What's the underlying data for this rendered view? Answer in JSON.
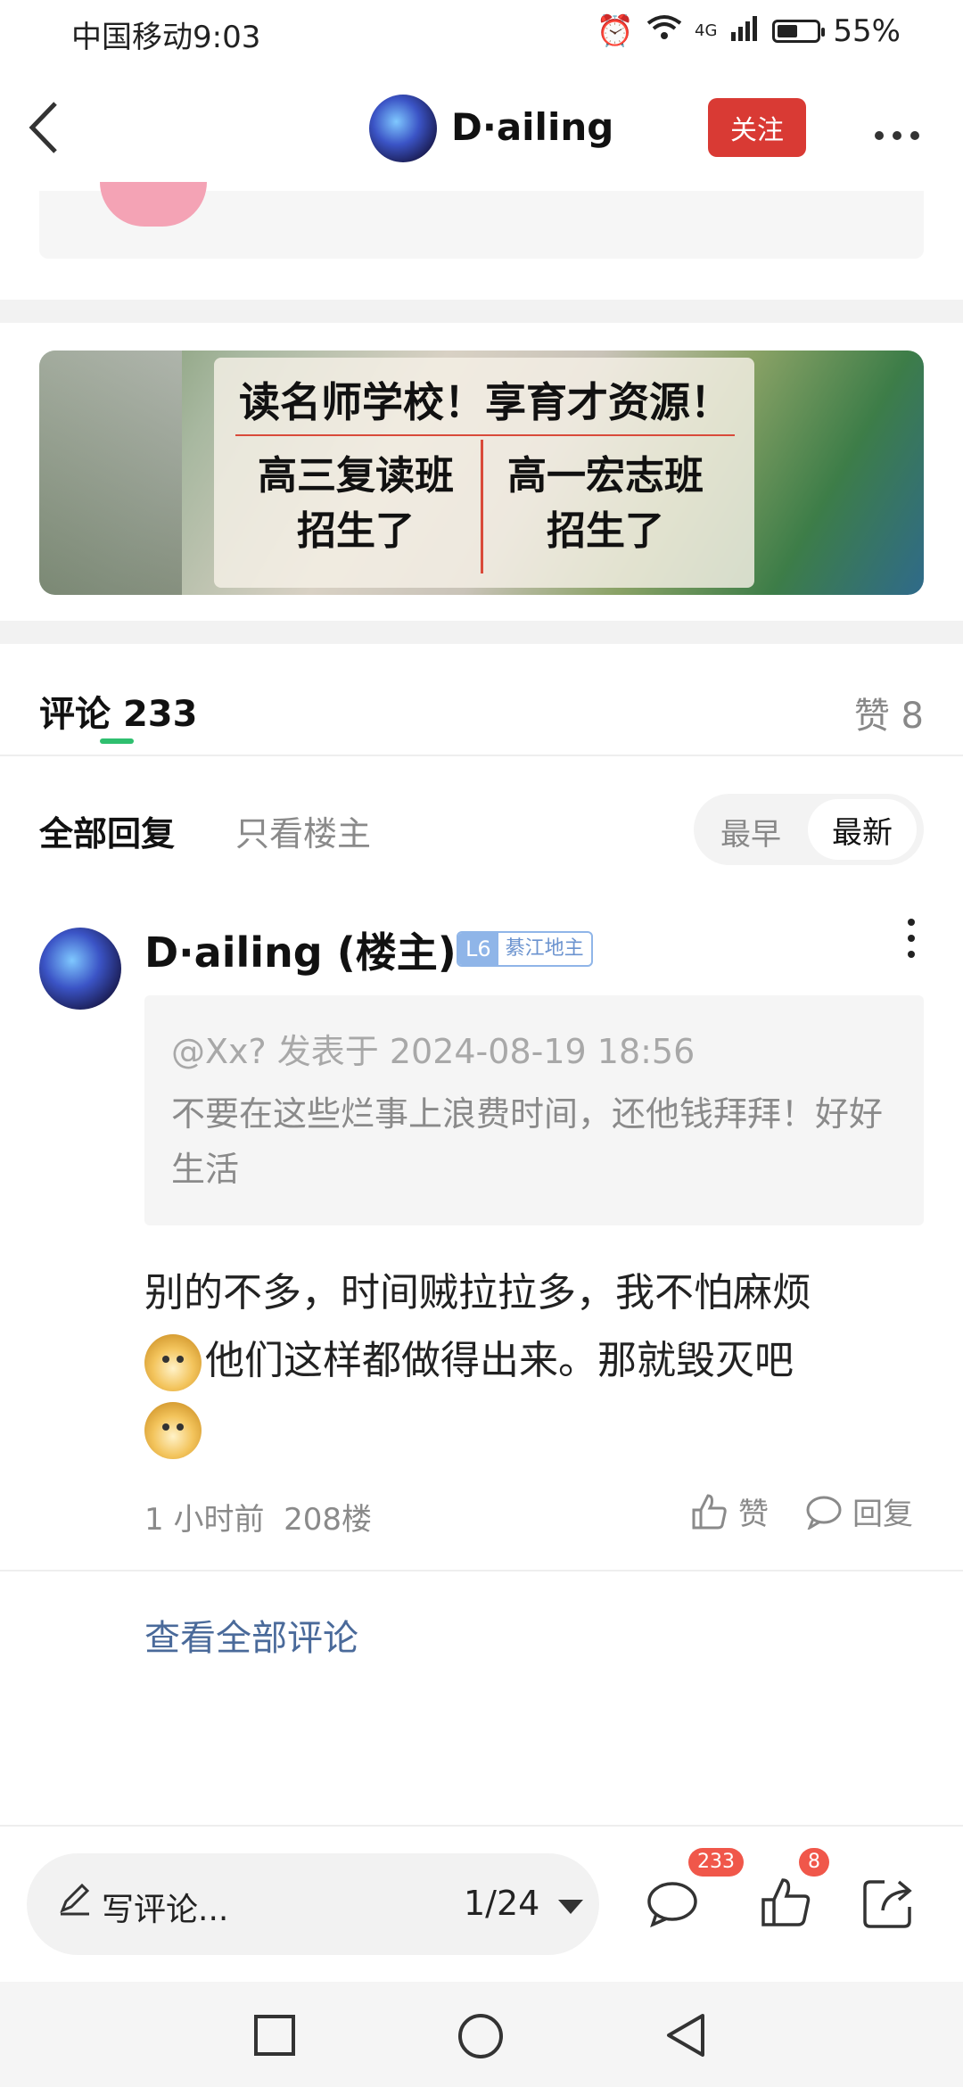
{
  "status_bar": {
    "carrier_time": "中国移动9:03",
    "network": "4G",
    "battery": "55%",
    "battery_level": 0.55
  },
  "nav": {
    "back_icon": "chevron-left-icon",
    "title": "D·ailing",
    "follow_label": "关注",
    "more_icon": "more-horizontal-icon"
  },
  "banner": {
    "headline": "读名师学校！享育才资源！",
    "left_text": "高三复读班 招生了",
    "right_text": "高一宏志班 招生了"
  },
  "comments_header": {
    "tab_label": "评论",
    "count": "233",
    "likes_label": "赞 8"
  },
  "filters": {
    "all": "全部回复",
    "op_only": "只看楼主",
    "sort_earliest": "最早",
    "sort_latest": "最新"
  },
  "comment": {
    "author": "D·ailing (楼主)",
    "level": "L6",
    "title_badge": "綦江地主",
    "quote_header": "@Xx? 发表于 2024-08-19 18:56",
    "quote_text": "不要在这些烂事上浪费时间，还他钱拜拜！好好生活",
    "line1": "别的不多，时间贼拉拉多，我不怕麻烦",
    "line2": "他们这样都做得出来。那就毁灭吧",
    "time": "1 小时前",
    "floor": "208楼",
    "like_label": "赞",
    "reply_label": "回复"
  },
  "view_all": "查看全部评论",
  "toolbar": {
    "input_placeholder": "写评论...",
    "page": "1/24",
    "comment_badge": "233",
    "like_badge": "8"
  },
  "colors": {
    "accent_red": "#d93a34",
    "tab_underline": "#2fbf6f",
    "link_blue": "#4a6a9a"
  }
}
